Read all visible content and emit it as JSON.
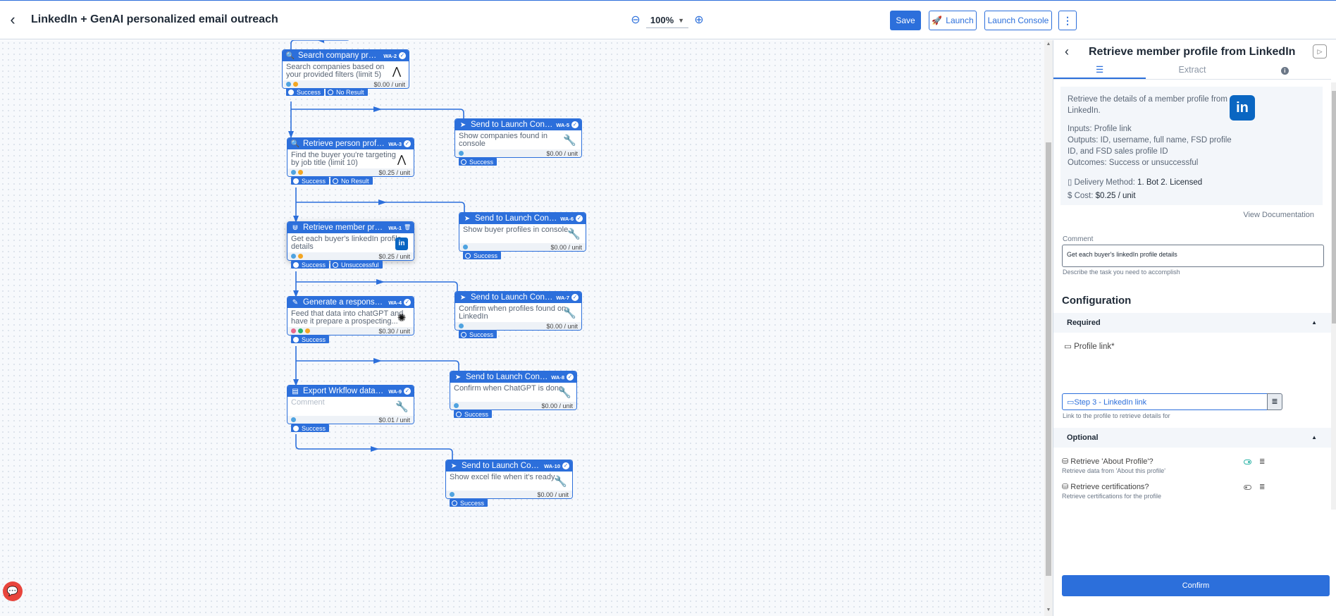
{
  "header": {
    "title": "LinkedIn + GenAI personalized email outreach",
    "zoom": "100%",
    "save_label": "Save",
    "launch_label": "Launch",
    "launch_console_label": "Launch Console"
  },
  "colors": {
    "accent": "#2c6fdb",
    "linkedin": "#0a66c2",
    "toggle_on": "#2ab3a6",
    "chat": "#e8453c"
  },
  "nodes": [
    {
      "title": "Search company profile i...",
      "wa": "WA-2",
      "desc": "Search companies based on your provided filters (limit 5)",
      "cost": "$0.00 / unit",
      "icon": "search-icon",
      "logo": "apollo-logo",
      "outcomes": [
        "Success",
        "No Result"
      ]
    },
    {
      "title": "Retrieve person profile d...",
      "wa": "WA-3",
      "desc": "Find the buyer you're targeting by job title (limit 10)",
      "cost": "$0.25 / unit",
      "icon": "search-icon",
      "logo": "apollo-logo",
      "outcomes": [
        "Success",
        "No Result"
      ]
    },
    {
      "title": "Retrieve member profile f...",
      "wa": "WA-1",
      "desc": "Get each buyer's linkedIn profile details",
      "cost": "$0.25 / unit",
      "icon": "magnet-icon",
      "logo": "linkedin-logo",
      "outcomes": [
        "Success",
        "Unsuccessful"
      ]
    },
    {
      "title": "Generate a response wit...",
      "wa": "WA-4",
      "desc": "Feed that data into chatGPT and have it prepare a prospecting...",
      "cost": "$0.30 / unit",
      "icon": "wand-icon",
      "logo": "openai-logo",
      "outcomes": [
        "Success"
      ]
    },
    {
      "title": "Export Wrkflow data to file",
      "wa": "WA-9",
      "desc": "Comment",
      "cost": "$0.01 / unit",
      "icon": "file-export-icon",
      "logo": "wrench-icon",
      "outcomes": [
        "Success"
      ]
    },
    {
      "title": "Send to Launch Console",
      "wa": "WA-5",
      "desc": "Show companies found in console",
      "cost": "$0.00 / unit",
      "icon": "send-icon",
      "logo": "wrench-icon",
      "outcomes": [
        "Success"
      ]
    },
    {
      "title": "Send to Launch Console",
      "wa": "WA-6",
      "desc": "Show buyer profiles in console",
      "cost": "$0.00 / unit",
      "icon": "send-icon",
      "logo": "wrench-icon",
      "outcomes": [
        "Success"
      ]
    },
    {
      "title": "Send to Launch Console",
      "wa": "WA-7",
      "desc": "Confirm when profiles found on LinkedIn",
      "cost": "$0.00 / unit",
      "icon": "send-icon",
      "logo": "wrench-icon",
      "outcomes": [
        "Success"
      ]
    },
    {
      "title": "Send to Launch Console",
      "wa": "WA-8",
      "desc": "Confirm when ChatGPT is done",
      "cost": "$0.00 / unit",
      "icon": "send-icon",
      "logo": "wrench-icon",
      "outcomes": [
        "Success"
      ]
    },
    {
      "title": "Send to Launch Console",
      "wa": "WA-10",
      "desc": "Show excel file when it's ready",
      "cost": "$0.00 / unit",
      "icon": "send-icon",
      "logo": "wrench-icon",
      "outcomes": [
        "Success"
      ]
    }
  ],
  "panel": {
    "title": "Retrieve member profile from LinkedIn",
    "tabs": [
      "",
      "Extract",
      ""
    ],
    "description": "Retrieve the details of a member profile from LinkedIn.",
    "inputs": "Inputs: Profile link",
    "outputs": "Outputs: ID, username, full name, FSD profile ID, and FSD sales profile ID",
    "outcomes": "Outcomes: Success or unsuccessful",
    "delivery_label": "Delivery Method:",
    "delivery_value": "1. Bot 2. Licensed",
    "cost_label": "Cost:",
    "cost_value": "$0.25 / unit",
    "view_docs": "View Documentation",
    "comment_label": "Comment",
    "comment_value": "Get each buyer's linkedIn profile details",
    "comment_hint": "Describe the task you need to accomplish",
    "configuration": "Configuration",
    "required": "Required",
    "profile_link_label": "Profile link*",
    "profile_link_value": "Step 3 - LinkedIn link",
    "profile_link_hint": "Link to the profile to retrieve details for",
    "optional": "Optional",
    "options": [
      {
        "label": "Retrieve 'About Profile'?",
        "sub": "Retrieve data from 'About this profile'",
        "on": true
      },
      {
        "label": "Retrieve certifications?",
        "sub": "Retrieve certifications for the profile",
        "on": false
      }
    ],
    "confirm": "Confirm"
  }
}
